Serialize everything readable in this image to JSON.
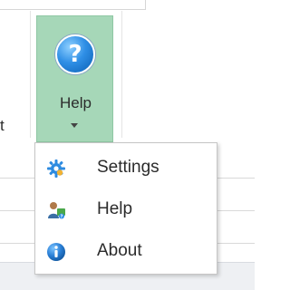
{
  "ribbon": {
    "partial_label": "t",
    "help_button": {
      "label": "Help",
      "icon": "help-question-icon",
      "icon_glyph": "?",
      "pressed": true,
      "accent": "#a6d7b8"
    }
  },
  "menu": {
    "items": [
      {
        "label": "Settings",
        "icon": "gear-icon"
      },
      {
        "label": "Help",
        "icon": "help-person-icon"
      },
      {
        "label": "About",
        "icon": "info-icon"
      }
    ]
  },
  "colors": {
    "help_blue": "#2f8fe6",
    "gear_blue": "#2d8be0",
    "info_blue": "#1f6fc8"
  }
}
